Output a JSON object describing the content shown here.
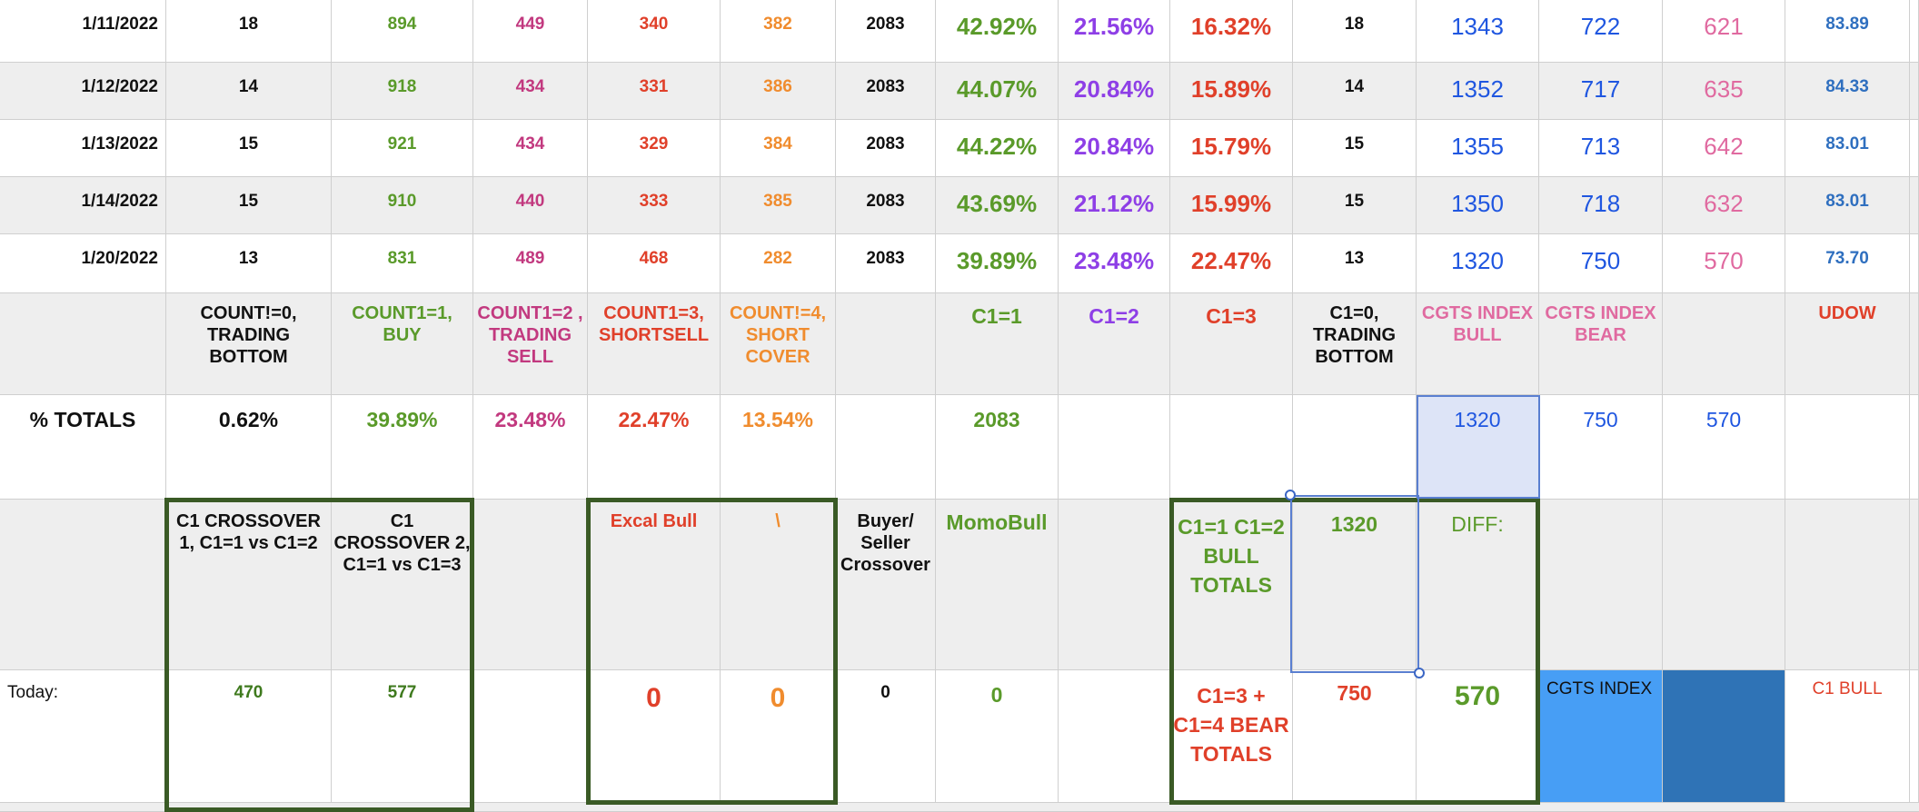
{
  "colors": {
    "black": "#111111",
    "green": "#5a9a2a",
    "magenta": "#c2397f",
    "red": "#e0402a",
    "orange": "#f08c2e",
    "purple": "#8e3fe6",
    "blue": "#1f56e0",
    "pink": "#e06aa0",
    "steel": "#2f6fbf",
    "darkgreen": "#3f7a1e",
    "cell_blue": "#479ef5",
    "cell_dark": "#2f73b6",
    "box_border": "#3a5a25"
  },
  "data_rows": [
    {
      "date": "1/11/2022",
      "c0": "18",
      "c1": "894",
      "c2": "449",
      "c3": "340",
      "c4": "382",
      "total": "2083",
      "p1": "42.92%",
      "p2": "21.56%",
      "p3": "16.32%",
      "t0": "18",
      "bull": "1343",
      "bear": "722",
      "diff": "621",
      "udow": "83.89"
    },
    {
      "date": "1/12/2022",
      "c0": "14",
      "c1": "918",
      "c2": "434",
      "c3": "331",
      "c4": "386",
      "total": "2083",
      "p1": "44.07%",
      "p2": "20.84%",
      "p3": "15.89%",
      "t0": "14",
      "bull": "1352",
      "bear": "717",
      "diff": "635",
      "udow": "84.33"
    },
    {
      "date": "1/13/2022",
      "c0": "15",
      "c1": "921",
      "c2": "434",
      "c3": "329",
      "c4": "384",
      "total": "2083",
      "p1": "44.22%",
      "p2": "20.84%",
      "p3": "15.79%",
      "t0": "15",
      "bull": "1355",
      "bear": "713",
      "diff": "642",
      "udow": "83.01"
    },
    {
      "date": "1/14/2022",
      "c0": "15",
      "c1": "910",
      "c2": "440",
      "c3": "333",
      "c4": "385",
      "total": "2083",
      "p1": "43.69%",
      "p2": "21.12%",
      "p3": "15.99%",
      "t0": "15",
      "bull": "1350",
      "bear": "718",
      "diff": "632",
      "udow": "83.01"
    },
    {
      "date": "1/20/2022",
      "c0": "13",
      "c1": "831",
      "c2": "489",
      "c3": "468",
      "c4": "282",
      "total": "2083",
      "p1": "39.89%",
      "p2": "23.48%",
      "p3": "22.47%",
      "t0": "13",
      "bull": "1320",
      "bear": "750",
      "diff": "570",
      "udow": "73.70"
    }
  ],
  "headers": {
    "c0": "COUNT!=0, TRADING BOTTOM",
    "c1": "COUNT1=1, BUY",
    "c2": "COUNT1=2 , TRADING SELL",
    "c3": "COUNT1=3, SHORTSELL",
    "c4": "COUNT!=4, SHORT COVER",
    "p1": "C1=1",
    "p2": "C1=2",
    "p3": "C1=3",
    "t0": "C1=0, TRADING BOTTOM",
    "bull": "CGTS INDEX BULL",
    "bear": "CGTS INDEX BEAR",
    "udow": "UDOW"
  },
  "totals": {
    "label": "% TOTALS",
    "c0": "0.62%",
    "c1": "39.89%",
    "c2": "23.48%",
    "c3": "22.47%",
    "c4": "13.54%",
    "p1": "2083",
    "bull": "1320",
    "bear": "750",
    "diff": "570"
  },
  "summary_headers": {
    "cross1": "C1 CROSSOVER 1, C1=1 vs C1=2",
    "cross2": "C1 CROSSOVER 2, C1=1 vs C1=3",
    "excal": "Excal Bull",
    "slash": "\\",
    "buyer": "Buyer/ Seller Crossover",
    "momo": "MomoBull",
    "bull_totals": "C1=1 C1=2 BULL TOTALS",
    "bull_val": "1320",
    "diff_label": "DIFF:"
  },
  "today": {
    "label": "Today:",
    "cross1": "470",
    "cross2": "577",
    "excal": "0",
    "slash": "0",
    "buyer": "0",
    "momo": "0",
    "bear_totals": "C1=3 + C1=4 BEAR TOTALS",
    "bear_val": "750",
    "diff_val": "570",
    "cgts_index": "CGTS INDEX",
    "c1_bull": "C1 BULL"
  }
}
